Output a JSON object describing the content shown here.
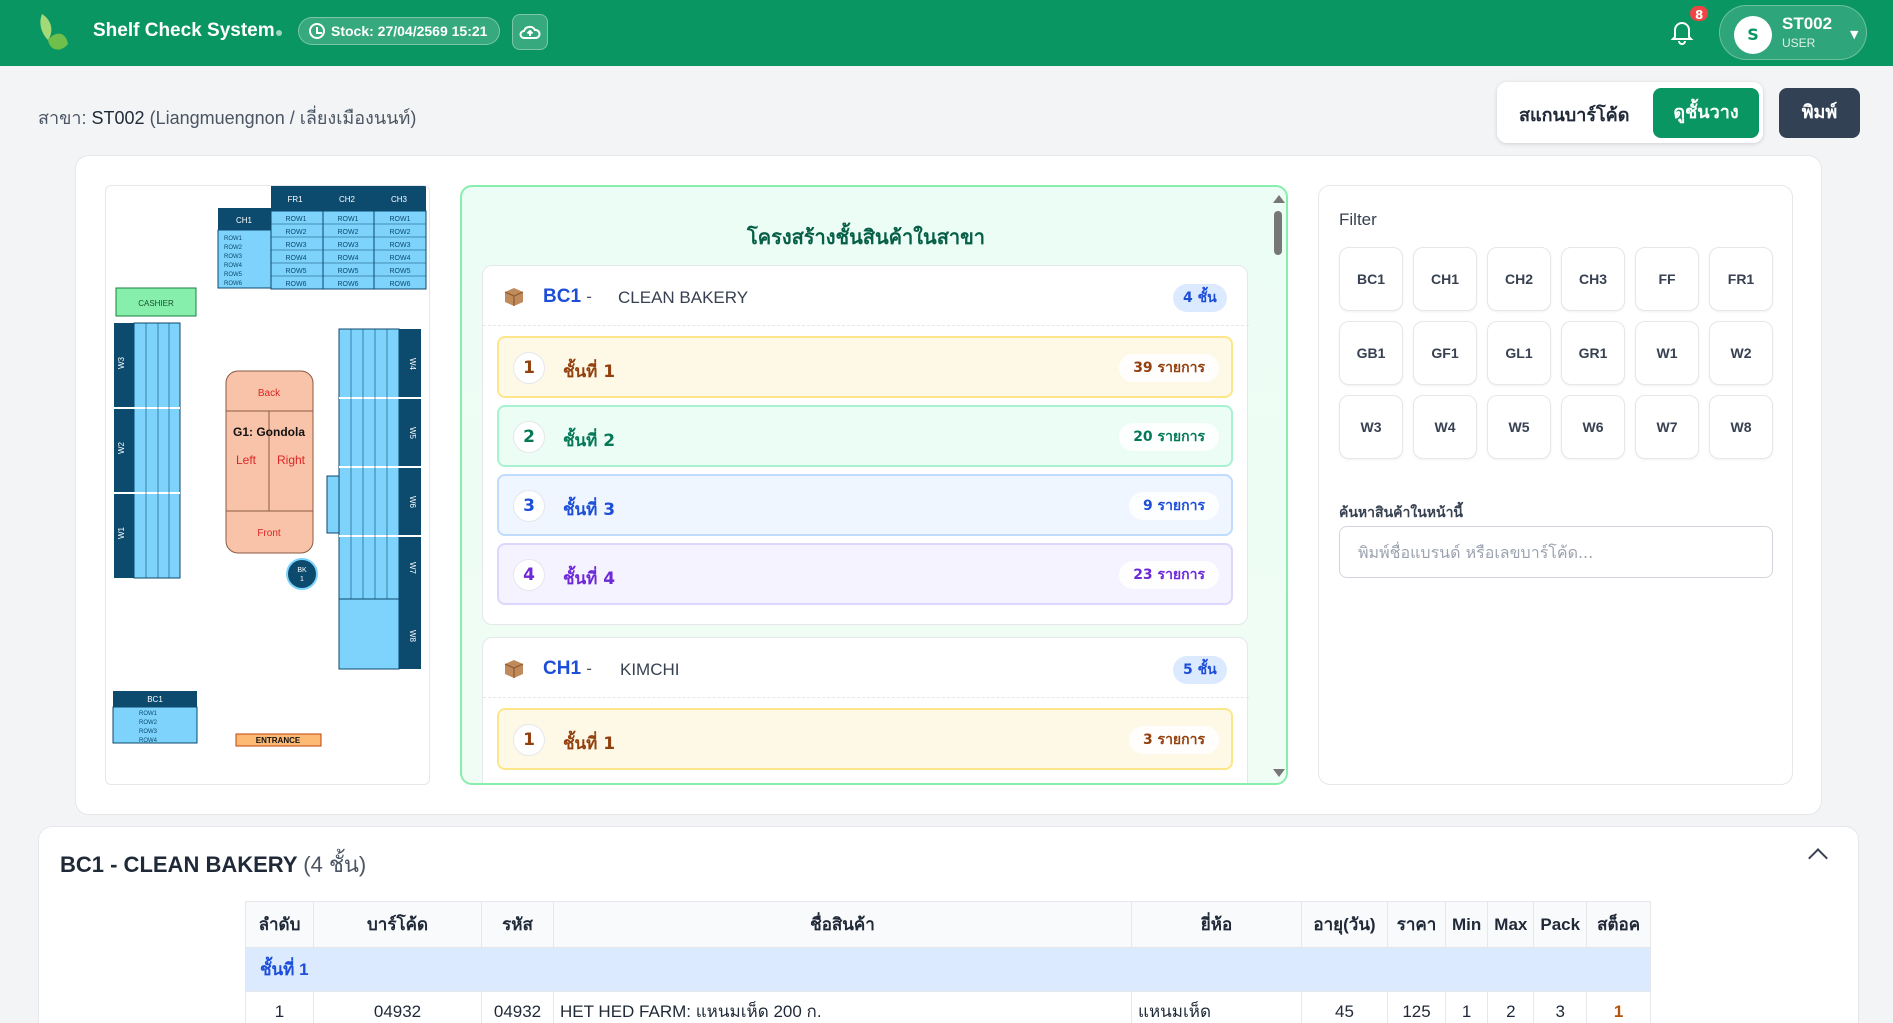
{
  "header": {
    "app_title": "Shelf Check System",
    "stock_label": "Stock: 27/04/2569 15:21",
    "notification_count": "8",
    "user": {
      "avatar_letter": "S",
      "name": "ST002",
      "role": "USER"
    }
  },
  "branch": {
    "label": "สาขา:",
    "code": "ST002",
    "name": "(Liangmuengnon / เลี่ยงเมืองนนท์)"
  },
  "actions": {
    "scan": "สแกนบาร์โค้ด",
    "view": "ดูชั้นวาง",
    "print": "พิมพ์"
  },
  "map": {
    "top_cols": [
      "FR1",
      "CH2",
      "CH3"
    ],
    "top_left": "CH1",
    "rows": [
      "ROW1",
      "ROW2",
      "ROW3",
      "ROW4",
      "ROW5",
      "ROW6"
    ],
    "cashier": "CASHIER",
    "left_blocks": [
      "W3",
      "W2",
      "W1"
    ],
    "right_blocks": [
      "W4",
      "W5",
      "W6",
      "W7",
      "W8"
    ],
    "gondola": {
      "back": "Back",
      "name": "G1: Gondola",
      "left": "Left",
      "right": "Right",
      "front": "Front"
    },
    "bk": "BK",
    "bk_num": "1",
    "bc1": "BC1",
    "bc1_rows": [
      "ROW1",
      "ROW2",
      "ROW3",
      "ROW4"
    ],
    "entrance": "ENTRANCE"
  },
  "structure": {
    "title": "โครงสร้างชั้นสินค้าในสาขา",
    "groups": [
      {
        "code": "BC1",
        "name": "CLEAN BAKERY",
        "count": "4 ชั้น",
        "shelves": [
          {
            "num": "1",
            "label": "ชั้นที่ 1",
            "count": "39 รายการ"
          },
          {
            "num": "2",
            "label": "ชั้นที่ 2",
            "count": "20 รายการ"
          },
          {
            "num": "3",
            "label": "ชั้นที่ 3",
            "count": "9 รายการ"
          },
          {
            "num": "4",
            "label": "ชั้นที่ 4",
            "count": "23 รายการ"
          }
        ]
      },
      {
        "code": "CH1",
        "name": "KIMCHI",
        "count": "5 ชั้น",
        "shelves": [
          {
            "num": "1",
            "label": "ชั้นที่ 1",
            "count": "3 รายการ"
          }
        ]
      }
    ]
  },
  "filter": {
    "title": "Filter",
    "chips": [
      "BC1",
      "CH1",
      "CH2",
      "CH3",
      "FF",
      "FR1",
      "GB1",
      "GF1",
      "GL1",
      "GR1",
      "W1",
      "W2",
      "W3",
      "W4",
      "W5",
      "W6",
      "W7",
      "W8"
    ],
    "search_label": "ค้นหาสินค้าในหน้านี้",
    "search_placeholder": "พิมพ์ชื่อแบรนด์ หรือเลขบาร์โค้ด..."
  },
  "table": {
    "title": "BC1 - CLEAN BAKERY",
    "subtitle": "(4 ชั้น)",
    "columns": [
      "ลำดับ",
      "บาร์โค้ด",
      "รหัส",
      "ชื่อสินค้า",
      "ยี่ห้อ",
      "อายุ(วัน)",
      "ราคา",
      "Min",
      "Max",
      "Pack",
      "สต็อค"
    ],
    "section": "ชั้นที่ 1",
    "rows": [
      [
        "1",
        "04932",
        "04932",
        "HET HED FARM: แหนมเห็ด 200 ก.",
        "แหนมเห็ด",
        "45",
        "125",
        "1",
        "2",
        "3",
        "1"
      ]
    ]
  },
  "colors": {
    "brand": "#0a9663",
    "primary_text": "#1d4ed8",
    "dark_button": "#334155"
  }
}
